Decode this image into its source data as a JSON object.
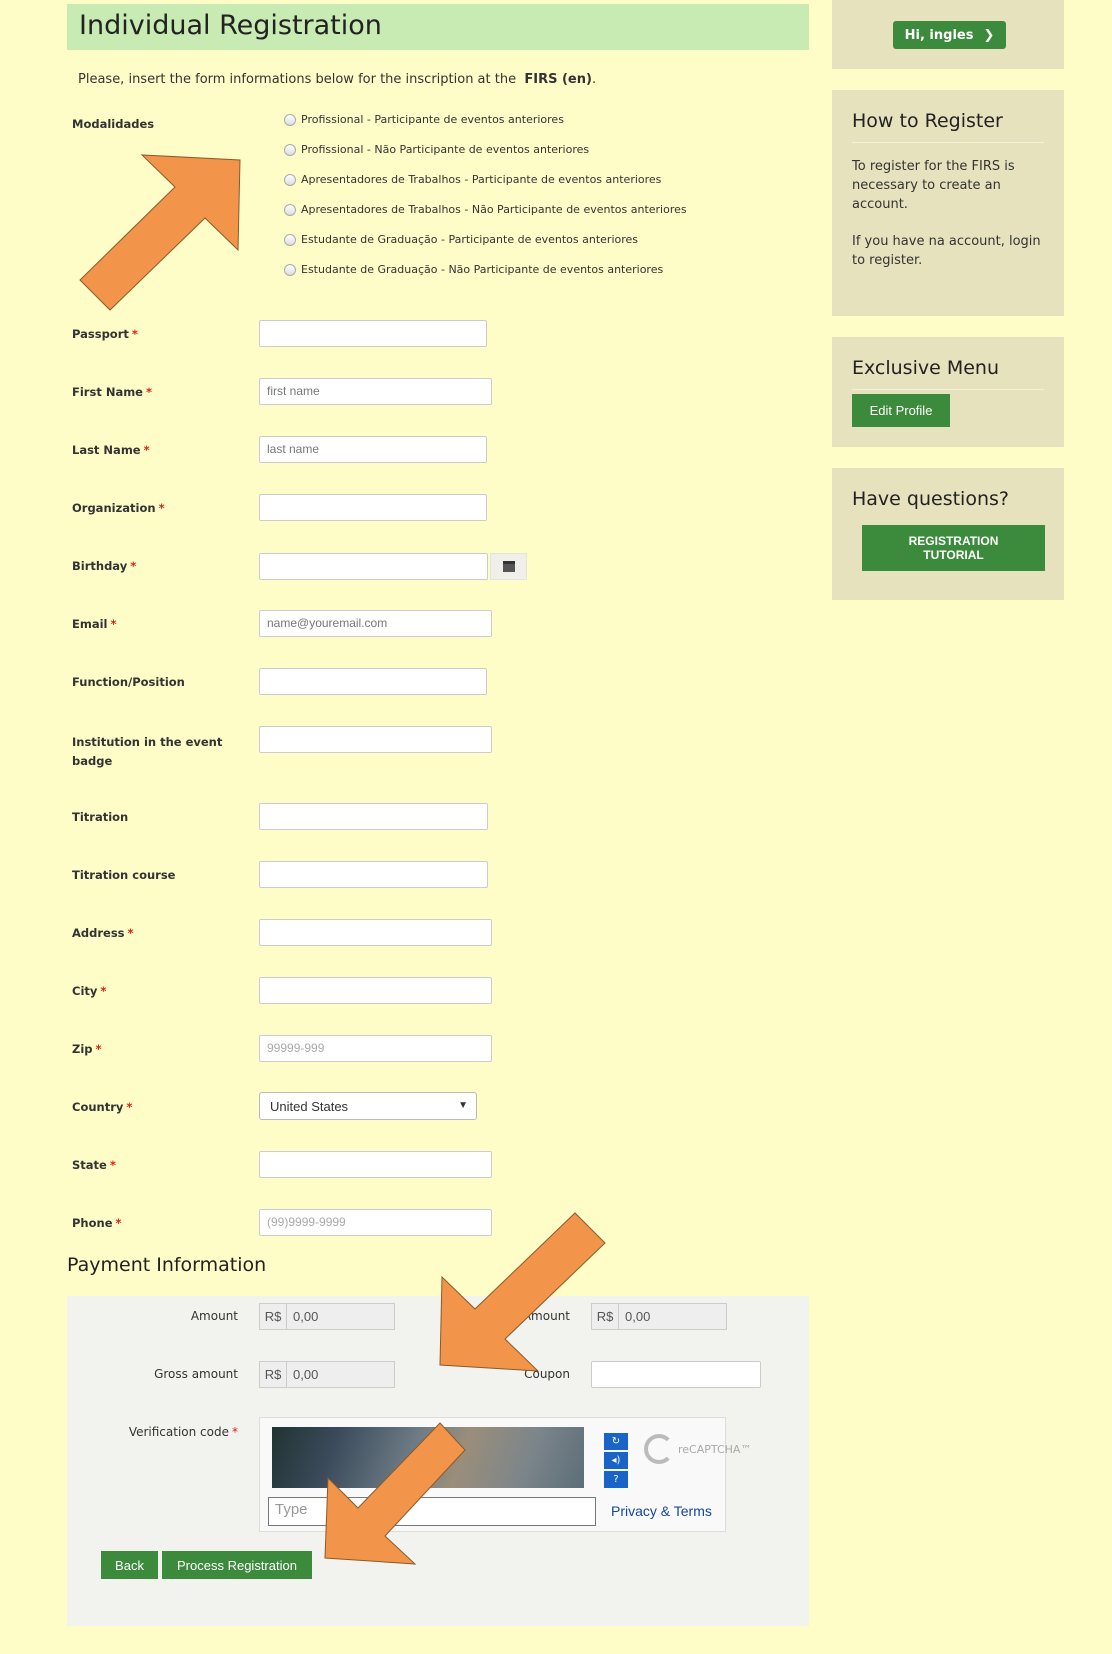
{
  "page": {
    "title": "Individual Registration",
    "intro_prefix": "Please, insert the form informations below for the inscription at the",
    "intro_event": "FIRS (en)",
    "intro_suffix": "."
  },
  "modalidades": {
    "label": "Modalidades",
    "options": [
      "Profissional - Participante de eventos anteriores",
      "Profissional - Não Participante de eventos anteriores",
      "Apresentadores de Trabalhos - Participante de eventos anteriores",
      "Apresentadores de Trabalhos - Não Participante de eventos anteriores",
      "Estudante de Graduação - Participante de eventos anteriores",
      "Estudante de Graduação - Não Participante de eventos anteriores"
    ]
  },
  "fields": {
    "passport": {
      "label": "Passport",
      "placeholder": ""
    },
    "first_name": {
      "label": "First Name",
      "placeholder": "first name"
    },
    "last_name": {
      "label": "Last Name",
      "placeholder": "last name"
    },
    "organization": {
      "label": "Organization",
      "placeholder": ""
    },
    "birthday": {
      "label": "Birthday",
      "placeholder": ""
    },
    "email": {
      "label": "Email",
      "placeholder": "name@youremail.com"
    },
    "function": {
      "label": "Function/Position",
      "placeholder": ""
    },
    "institution": {
      "label": "Institution in the event badge",
      "placeholder": ""
    },
    "titration": {
      "label": "Titration",
      "placeholder": ""
    },
    "titration_course": {
      "label": "Titration course",
      "placeholder": ""
    },
    "address": {
      "label": "Address",
      "placeholder": ""
    },
    "city": {
      "label": "City",
      "placeholder": ""
    },
    "zip": {
      "label": "Zip",
      "placeholder": "99999-999"
    },
    "country": {
      "label": "Country",
      "value": "United States"
    },
    "state": {
      "label": "State",
      "placeholder": ""
    },
    "phone": {
      "label": "Phone",
      "placeholder": "(99)9999-9999"
    },
    "required_marker": "*"
  },
  "payment": {
    "title": "Payment Information",
    "amount_label": "Amount",
    "amount_currency": "R$",
    "amount_value": "0,00",
    "amount2_label": "Amount",
    "amount2_currency": "R$",
    "amount2_value": "0,00",
    "gross_label": "Gross amount",
    "gross_currency": "R$",
    "gross_value": "0,00",
    "coupon_label": "Coupon",
    "verification_label": "Verification code",
    "captcha_placeholder": "Type",
    "captcha_brand": "reCAPTCHA™",
    "privacy_terms": "Privacy & Terms"
  },
  "actions": {
    "back": "Back",
    "process": "Process Registration"
  },
  "sidebar": {
    "user_button": "Hi, ingles",
    "how_title": "How to Register",
    "how_p1": "To register for the FIRS is necessary to create an account.",
    "how_p2": "If you have na account, login to register.",
    "menu_title": "Exclusive Menu",
    "edit_profile": "Edit Profile",
    "questions_title": "Have questions?",
    "tutorial_line1": "REGISTRATION",
    "tutorial_line2": "TUTORIAL"
  },
  "colors": {
    "page_bg": "#fefdc8",
    "title_bg": "#c8eab3",
    "sidebar_bg": "#e6e2bd",
    "button_green": "#3c8a3c",
    "annotation_arrow": "#f2954a"
  }
}
